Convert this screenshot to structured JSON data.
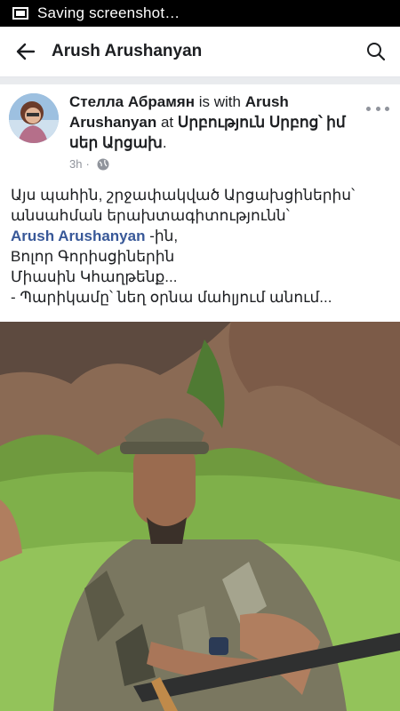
{
  "status_bar": {
    "text": "Saving screenshot…"
  },
  "app_bar": {
    "title": "Arush Arushanyan"
  },
  "post": {
    "author": "Стелла Абрамян",
    "with_text": " is with ",
    "tagged": "Arush Arushanyan",
    "at_text": " at ",
    "place": "Սրբություն Սրբոց՝ իմ սեր Արցախ",
    "period": ".",
    "time": "3h",
    "lines": [
      "Այս պահին, շրջափակված Արցախցիներիս՝",
      "անսահման երախտագիտությունն՝",
      "Bոլոր Գորիսցիներին",
      "Միասին Կհաղթենք...",
      "- Պարիկամը՝ նեղ օրնա մահլյում անում..."
    ],
    "mention": "Arush Arushanyan",
    "mention_suffix": " -ին,"
  },
  "icons": [
    "screenshot-icon",
    "back-arrow-icon",
    "search-icon",
    "globe-icon",
    "more-options-icon"
  ]
}
